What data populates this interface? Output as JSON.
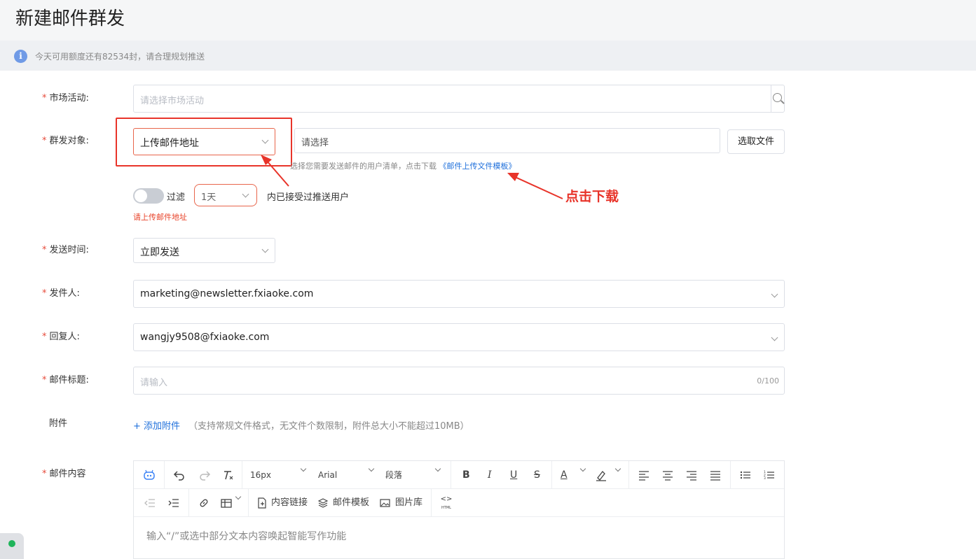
{
  "page": {
    "title": "新建邮件群发"
  },
  "notice": {
    "text": "今天可用额度还有82534封，请合理规划推送",
    "icon": "info-icon"
  },
  "form": {
    "campaign": {
      "label": "市场活动:",
      "placeholder": "请选择市场活动"
    },
    "recipients": {
      "label": "群发对象:",
      "type_value": "上传邮件地址",
      "file_placeholder": "请选择",
      "select_file_button": "选取文件",
      "hint_prefix": "选择您需要发送邮件的用户清单，点击下载",
      "template_link": "《邮件上传文件模板》"
    },
    "filter": {
      "toggle_label": "过滤",
      "days_value": "1天",
      "suffix": "内已接受过推送用户",
      "error": "请上传邮件地址"
    },
    "send_time": {
      "label": "发送时间:",
      "value": "立即发送"
    },
    "sender": {
      "label": "发件人:",
      "value": "marketing@newsletter.fxiaoke.com"
    },
    "reply_to": {
      "label": "回复人:",
      "value": "wangjy9508@fxiaoke.com"
    },
    "subject": {
      "label": "邮件标题:",
      "placeholder": "请输入",
      "counter": "0/100"
    },
    "attachment": {
      "label": "附件",
      "add_label": "+ 添加附件",
      "note": "（支持常规文件格式，无文件个数限制，附件总大小不能超过10MB）"
    },
    "content": {
      "label": "邮件内容",
      "editor_placeholder": "输入“/”或选中部分文本内容唤起智能写作功能",
      "toolbar": {
        "font_size": "16px",
        "font_family": "Arial",
        "block_format": "段落",
        "content_link": "内容链接",
        "mail_template": "邮件模板",
        "image_library": "图片库",
        "html_label": "HTML"
      }
    }
  },
  "annotation": {
    "text": "点击下载"
  },
  "colors": {
    "required_star": "#e74c3c",
    "link": "#1e6fdb",
    "annotation_red": "#e8342a",
    "error": "#e8432a"
  }
}
